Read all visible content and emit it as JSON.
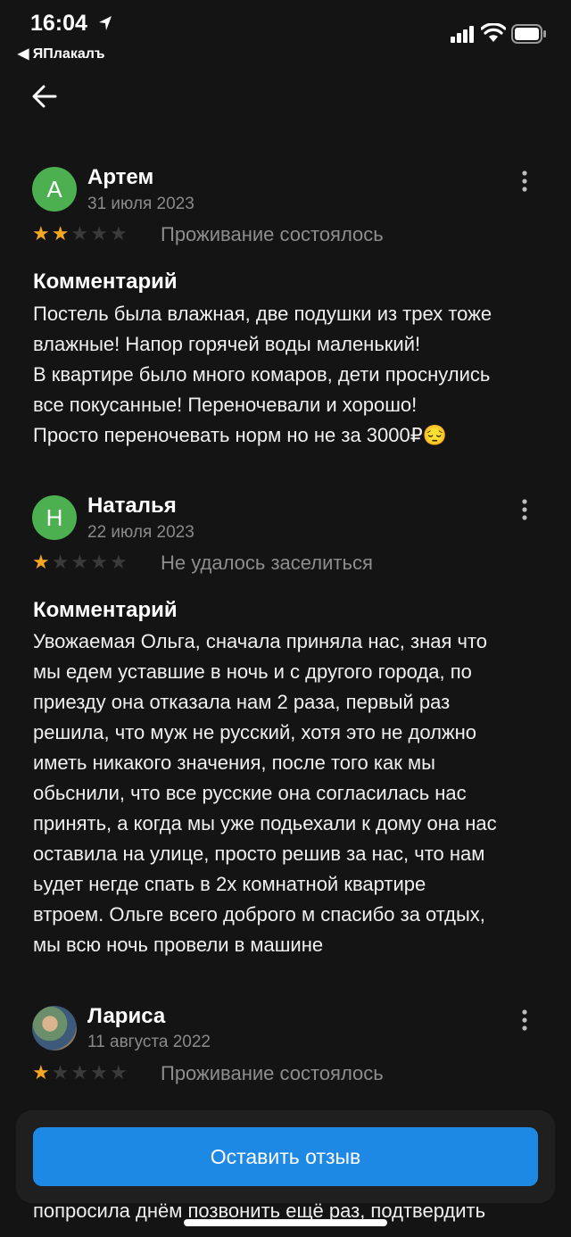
{
  "status_bar": {
    "time": "16:04",
    "back_app": "ЯПлакалъ"
  },
  "reviews": [
    {
      "initial": "А",
      "name": "Артем",
      "date": "31 июля 2023",
      "rating": 2,
      "stay_status": "Проживание состоялось",
      "comment_title": "Комментарий",
      "comment": "Постель была влажная, две подушки из трех тоже\nвлажные! Напор горячей воды маленький!\nВ квартире было много комаров, дети проснулись\nвсе покусанные! Переночевали и хорошо!\nПросто переночевать норм но не за 3000₽😔"
    },
    {
      "initial": "Н",
      "name": "Наталья",
      "date": "22 июля 2023",
      "rating": 1,
      "stay_status": "Не удалось заселиться",
      "comment_title": "Комментарий",
      "comment": "Увожаемая Ольга, сначала приняла нас, зная что\nмы едем уставшие в ночь и с другого города, по\nприезду она отказала нам 2 раза, первый раз\nрешила, что муж не русский, хотя это не должно\nиметь никакого значения, после того как мы\nобьснили, что все русские она согласилась нас\nпринять, а когда мы уже подьехали к дому она нас\nоставила на улице, просто решив за нас, что нам\nьудет негде спать в 2х комнатной квартире\nвтроем. Ольге всего доброго м спасибо за отдых,\nмы всю ночь провели в машине"
    },
    {
      "name": "Лариса",
      "date": "11 августа 2022",
      "rating": 1,
      "stay_status": "Проживание состоялось"
    }
  ],
  "cta_label": "Оставить отзыв",
  "underlying_text": "попросила днём позвонить ещё раз, подтвердить"
}
